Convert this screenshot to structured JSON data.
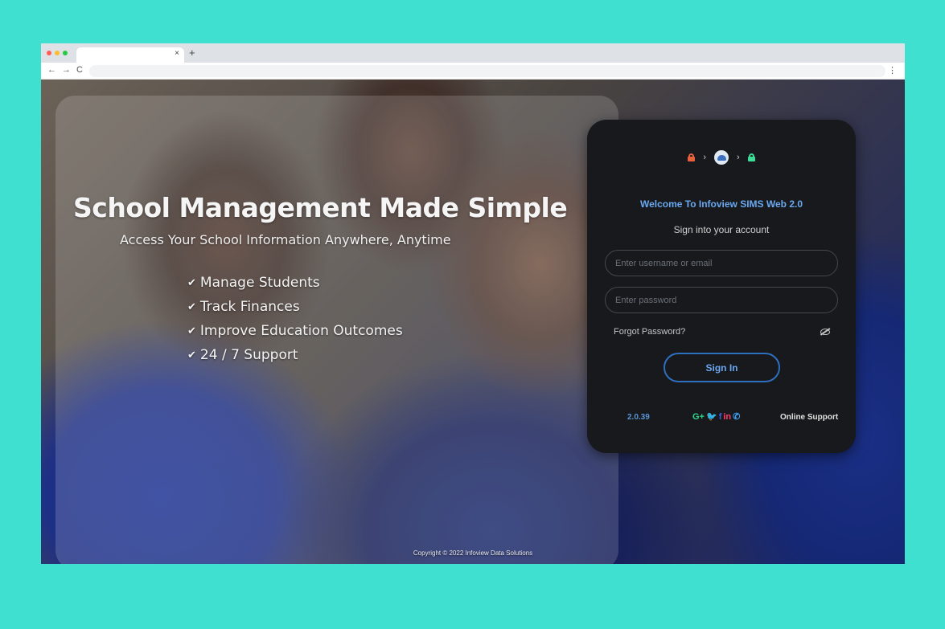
{
  "browser": {
    "tab_close": "×",
    "tab_new": "+",
    "nav": {
      "back": "←",
      "forward": "→",
      "reload": "C"
    },
    "menu": "⋮"
  },
  "hero": {
    "title": "School Management Made Simple",
    "subtitle": "Access Your School Information Anywhere, Anytime",
    "features": [
      "Manage Students",
      "Track Finances",
      "Improve Education Outcomes",
      "24 / 7 Support"
    ],
    "check_glyph": "✔"
  },
  "login": {
    "welcome": "Welcome To Infoview SIMS Web 2.0",
    "subtitle": "Sign into your account",
    "username_placeholder": "Enter username or email",
    "password_placeholder": "Enter password",
    "forgot_password": "Forgot Password?",
    "sign_in": "Sign In",
    "version": "2.0.39",
    "online_support": "Online Support",
    "progress": {
      "chevron": "›",
      "lock_locked_color": "#e8613a",
      "lock_open_color": "#3ddc97"
    },
    "socials": [
      {
        "label": "G+",
        "icon": "google-plus-icon",
        "color": "#2ed38c"
      },
      {
        "label": "🐦",
        "icon": "twitter-icon",
        "color": "#1da1f2"
      },
      {
        "label": "f",
        "icon": "facebook-icon",
        "color": "#3b5fd8"
      },
      {
        "label": "in",
        "icon": "linkedin-icon",
        "color": "#ff3b6b"
      },
      {
        "label": "✆",
        "icon": "phone-icon",
        "color": "#3aa0f0"
      }
    ]
  },
  "footer": {
    "copyright": "Copyright © 2022 Infoview Data Solutions"
  },
  "colors": {
    "page_background": "#40e0d0",
    "card_background": "#17191c",
    "accent": "#6aa8f0"
  }
}
